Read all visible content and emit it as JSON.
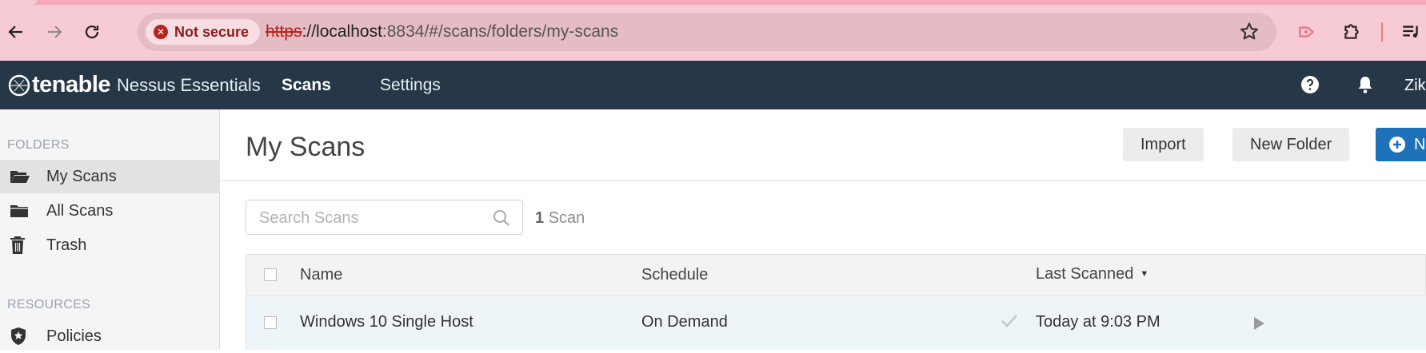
{
  "browser": {
    "security_chip": "Not secure",
    "url_protocol": "https",
    "url_host_prefix": "://localhost",
    "url_port_path": ":8834/#/scans/folders/my-scans"
  },
  "app": {
    "brand": "tenable",
    "product": "Nessus Essentials",
    "nav": [
      {
        "label": "Scans",
        "active": true
      },
      {
        "label": "Settings",
        "active": false
      }
    ],
    "user_label": "Zik"
  },
  "sidebar": {
    "folders_heading": "FOLDERS",
    "items": [
      {
        "label": "My Scans",
        "icon": "folder-open-icon",
        "active": true
      },
      {
        "label": "All Scans",
        "icon": "folder-icon",
        "active": false
      },
      {
        "label": "Trash",
        "icon": "trash-icon",
        "active": false
      }
    ],
    "resources_heading": "RESOURCES",
    "resources": [
      {
        "label": "Policies",
        "icon": "policy-shield-icon"
      }
    ]
  },
  "main": {
    "title": "My Scans",
    "buttons": {
      "import": "Import",
      "new_folder": "New Folder",
      "new_scan": "N"
    },
    "search_placeholder": "Search Scans",
    "count_number": "1",
    "count_label": "Scan",
    "table": {
      "columns": [
        "Name",
        "Schedule",
        "Last Scanned"
      ],
      "sort_indicator": "▼",
      "rows": [
        {
          "name": "Windows 10 Single Host",
          "schedule": "On Demand",
          "last_scanned": "Today at 9:03 PM"
        }
      ]
    }
  },
  "colors": {
    "header_bg": "#263847",
    "primary_button": "#1d71b8",
    "chrome_bg": "#f7cbd4",
    "selected_row": "#eef5f9"
  }
}
